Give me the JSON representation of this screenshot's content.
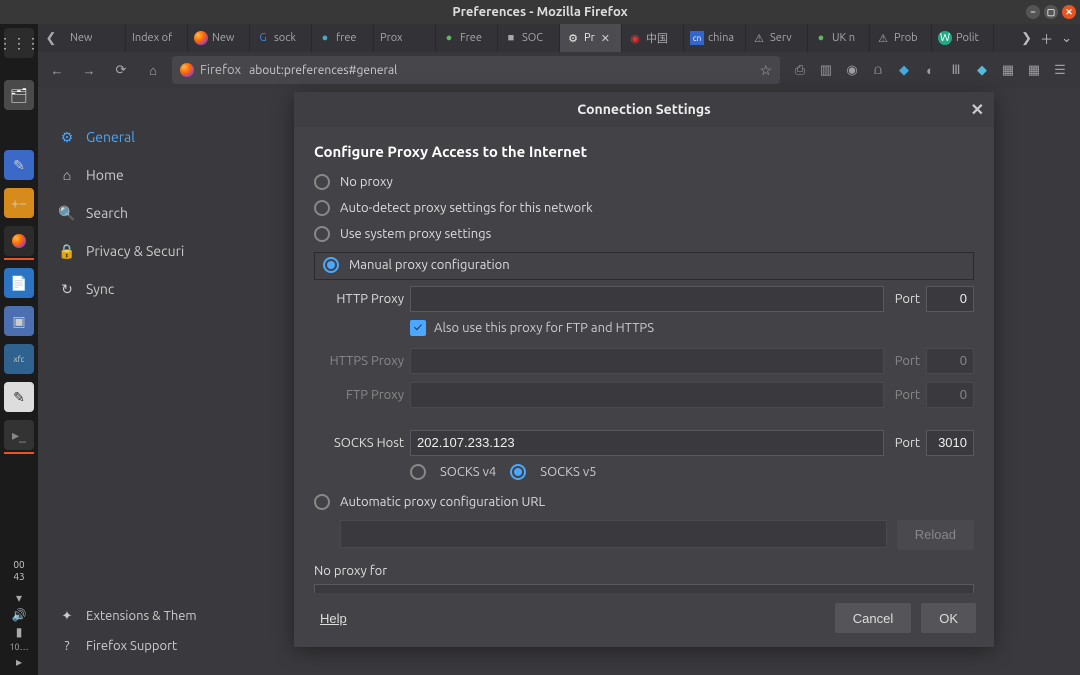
{
  "window": {
    "title": "Preferences - Mozilla Firefox"
  },
  "tabs": [
    {
      "label": "New",
      "icon": ""
    },
    {
      "label": "Index of",
      "icon": ""
    },
    {
      "label": "New",
      "icon": "ff"
    },
    {
      "label": "sock",
      "icon": "G"
    },
    {
      "label": "free",
      "icon": "●"
    },
    {
      "label": "Prox",
      "icon": ""
    },
    {
      "label": "Free",
      "icon": "●"
    },
    {
      "label": "SOC",
      "icon": "■"
    },
    {
      "label": "Pr",
      "icon": "⚙",
      "active": true
    },
    {
      "label": "中国",
      "icon": "○"
    },
    {
      "label": "china",
      "icon": "cn"
    },
    {
      "label": "Serv",
      "icon": "⚠"
    },
    {
      "label": "UK n",
      "icon": "●"
    },
    {
      "label": "Prob",
      "icon": "⚠"
    },
    {
      "label": "Polit",
      "icon": "W"
    }
  ],
  "url": {
    "identity": "Firefox",
    "address": "about:preferences#general"
  },
  "sidebar": {
    "items": [
      {
        "icon": "⚙",
        "label": "General",
        "name": "general",
        "active": true
      },
      {
        "icon": "⌂",
        "label": "Home",
        "name": "home"
      },
      {
        "icon": "🔍",
        "label": "Search",
        "name": "search"
      },
      {
        "icon": "🔒",
        "label": "Privacy & Securi",
        "name": "privacy"
      },
      {
        "icon": "↻",
        "label": "Sync",
        "name": "sync"
      }
    ],
    "footer": [
      {
        "icon": "✦",
        "label": "Extensions & Them"
      },
      {
        "icon": "?",
        "label": "Firefox Support"
      }
    ]
  },
  "modal": {
    "title": "Connection Settings",
    "heading": "Configure Proxy Access to the Internet",
    "options": {
      "no_proxy_label": "No proxy",
      "auto_detect_label": "Auto-detect proxy settings for this network",
      "system_label": "Use system proxy settings",
      "manual_label": "Manual proxy configuration",
      "pac_label": "Automatic proxy configuration URL"
    },
    "fields": {
      "http_label": "HTTP Proxy",
      "http_value": "",
      "http_port": "0",
      "also_ftp_https": "Also use this proxy for FTP and HTTPS",
      "https_label": "HTTPS Proxy",
      "https_value": "",
      "https_port": "0",
      "ftp_label": "FTP Proxy",
      "ftp_value": "",
      "ftp_port": "0",
      "socks_label": "SOCKS Host",
      "socks_value": "202.107.233.123",
      "socks_port": "3010",
      "port_label": "Port",
      "socksv4": "SOCKS v4",
      "socksv5": "SOCKS v5",
      "pac_value": "",
      "reload": "Reload",
      "no_proxy_for": "No proxy for"
    },
    "buttons": {
      "help": "Help",
      "cancel": "Cancel",
      "ok": "OK"
    }
  },
  "dock": {
    "time1": "00",
    "time2": "43",
    "bat": "10…"
  }
}
